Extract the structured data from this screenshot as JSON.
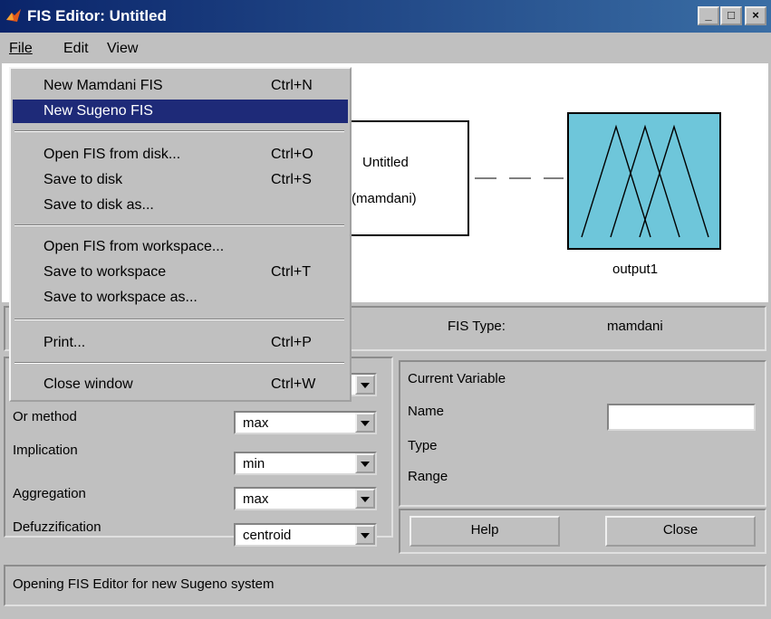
{
  "window": {
    "title": "FIS Editor: Untitled",
    "minimize": "_",
    "maximize": "□",
    "close": "×"
  },
  "menubar": {
    "file": "File",
    "edit": "Edit",
    "view": "View"
  },
  "file_menu": {
    "items": [
      {
        "label": "New Mamdani FIS",
        "accel": "Ctrl+N"
      },
      {
        "label": "New Sugeno FIS",
        "accel": ""
      },
      {
        "label": "Open FIS from disk...",
        "accel": "Ctrl+O"
      },
      {
        "label": "Save to disk",
        "accel": "Ctrl+S"
      },
      {
        "label": "Save to disk as...",
        "accel": ""
      },
      {
        "label": "Open FIS from workspace...",
        "accel": ""
      },
      {
        "label": "Save to workspace",
        "accel": "Ctrl+T"
      },
      {
        "label": "Save to workspace as...",
        "accel": ""
      },
      {
        "label": "Print...",
        "accel": "Ctrl+P"
      },
      {
        "label": "Close window",
        "accel": "Ctrl+W"
      }
    ],
    "selected_index": 1
  },
  "diagram": {
    "fis_name": "Untitled",
    "fis_type_paren": "(mamdani)",
    "output_name": "output1"
  },
  "fis_info": {
    "type_label": "FIS Type:",
    "type_value": "mamdani"
  },
  "methods": {
    "or_label": "Or method",
    "or_value": "max",
    "implication_label": "Implication",
    "implication_value": "min",
    "aggregation_label": "Aggregation",
    "aggregation_value": "max",
    "defuzz_label": "Defuzzification",
    "defuzz_value": "centroid"
  },
  "current_variable": {
    "heading": "Current Variable",
    "name_label": "Name",
    "name_value": "",
    "type_label": "Type",
    "range_label": "Range"
  },
  "buttons": {
    "help": "Help",
    "close": "Close"
  },
  "status": {
    "text": "Opening FIS Editor for new Sugeno system"
  },
  "colors": {
    "title_bar": "#0a246a",
    "selection": "#1e2a78",
    "output_fill": "#6ec6da",
    "background": "#c0c0c0"
  }
}
